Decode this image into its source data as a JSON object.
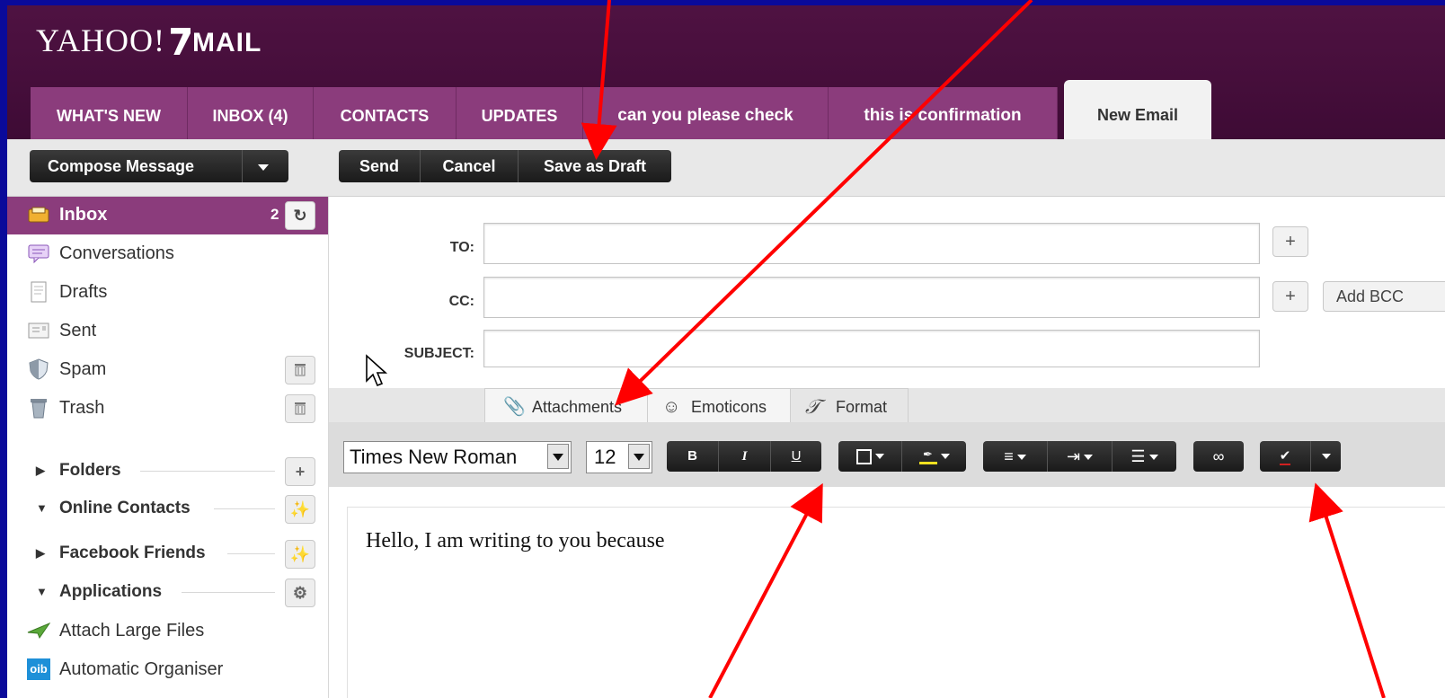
{
  "header": {
    "logo_text": "YAHOO!",
    "logo_product": "MAIL"
  },
  "tabs": [
    {
      "label": "WHAT'S NEW"
    },
    {
      "label": "INBOX (4)"
    },
    {
      "label": "CONTACTS"
    },
    {
      "label": "UPDATES"
    },
    {
      "label": "can you please check"
    },
    {
      "label": "this is confirmation"
    },
    {
      "label": "New Email"
    }
  ],
  "toolbar": {
    "compose_label": "Compose Message",
    "send_label": "Send",
    "cancel_label": "Cancel",
    "draft_label": "Save as Draft"
  },
  "sidebar": {
    "inbox": {
      "label": "Inbox",
      "count": "2"
    },
    "items": [
      {
        "label": "Conversations",
        "icon": "conversations-icon"
      },
      {
        "label": "Drafts",
        "icon": "drafts-icon"
      },
      {
        "label": "Sent",
        "icon": "sent-icon"
      },
      {
        "label": "Spam",
        "icon": "shield-icon"
      },
      {
        "label": "Trash",
        "icon": "trash-icon"
      }
    ],
    "groups": [
      {
        "label": "Folders",
        "expanded": false
      },
      {
        "label": "Online Contacts",
        "expanded": true
      },
      {
        "label": "Facebook Friends",
        "expanded": false
      },
      {
        "label": "Applications",
        "expanded": true
      }
    ],
    "apps": [
      {
        "label": "Attach Large Files",
        "icon": "paper-plane-icon"
      },
      {
        "label": "Automatic Organiser",
        "icon": "oib-icon",
        "badge": "oib"
      }
    ]
  },
  "compose": {
    "to_label": "TO:",
    "cc_label": "CC:",
    "subject_label": "SUBJECT:",
    "add_bcc_label": "Add BCC",
    "subtabs": [
      {
        "label": "Attachments",
        "icon": "paperclip-icon"
      },
      {
        "label": "Emoticons",
        "icon": "smiley-icon"
      },
      {
        "label": "Format",
        "icon": "format-icon"
      }
    ],
    "font_family": "Times New Roman",
    "font_size": "12",
    "format_buttons": {
      "bold": "B",
      "italic": "I",
      "underline": "U"
    },
    "body_text": "Hello, I am writing to you because"
  },
  "colors": {
    "header": "#4f1242",
    "tab": "#8b3c7c",
    "page_border": "#0a0a9a",
    "annotation_arrow": "#ff0000"
  }
}
